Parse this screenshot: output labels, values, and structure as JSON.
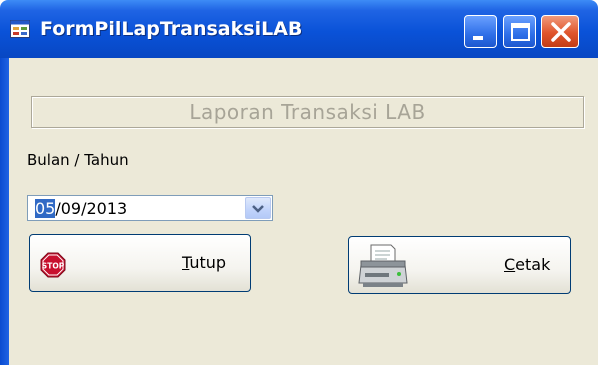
{
  "window": {
    "title": "FormPilLapTransaksiLAB",
    "icon": "form-app-icon",
    "controls": {
      "minimize": "minimize-icon",
      "maximize": "maximize-icon",
      "close": "close-icon"
    }
  },
  "group": {
    "title": "Laporan Transaksi LAB"
  },
  "period_label": "Bulan / Tahun",
  "date_picker": {
    "value": "05/09/2013",
    "selected_part": "05",
    "rest": "/09/2013",
    "dropdown_icon": "chevron-down-icon"
  },
  "buttons": {
    "tutup": {
      "accel": "T",
      "rest": "utup",
      "label": "Tutup",
      "icon": "stop-sign-icon"
    },
    "cetak": {
      "accel": "C",
      "rest": "etak",
      "label": "Cetak",
      "icon": "printer-icon"
    }
  },
  "colors": {
    "titlebar": "#0a52d8",
    "client_bg": "#ece9d8",
    "close_button": "#e0552c",
    "selection": "#316ac5",
    "disabled_text": "#a7a497"
  }
}
